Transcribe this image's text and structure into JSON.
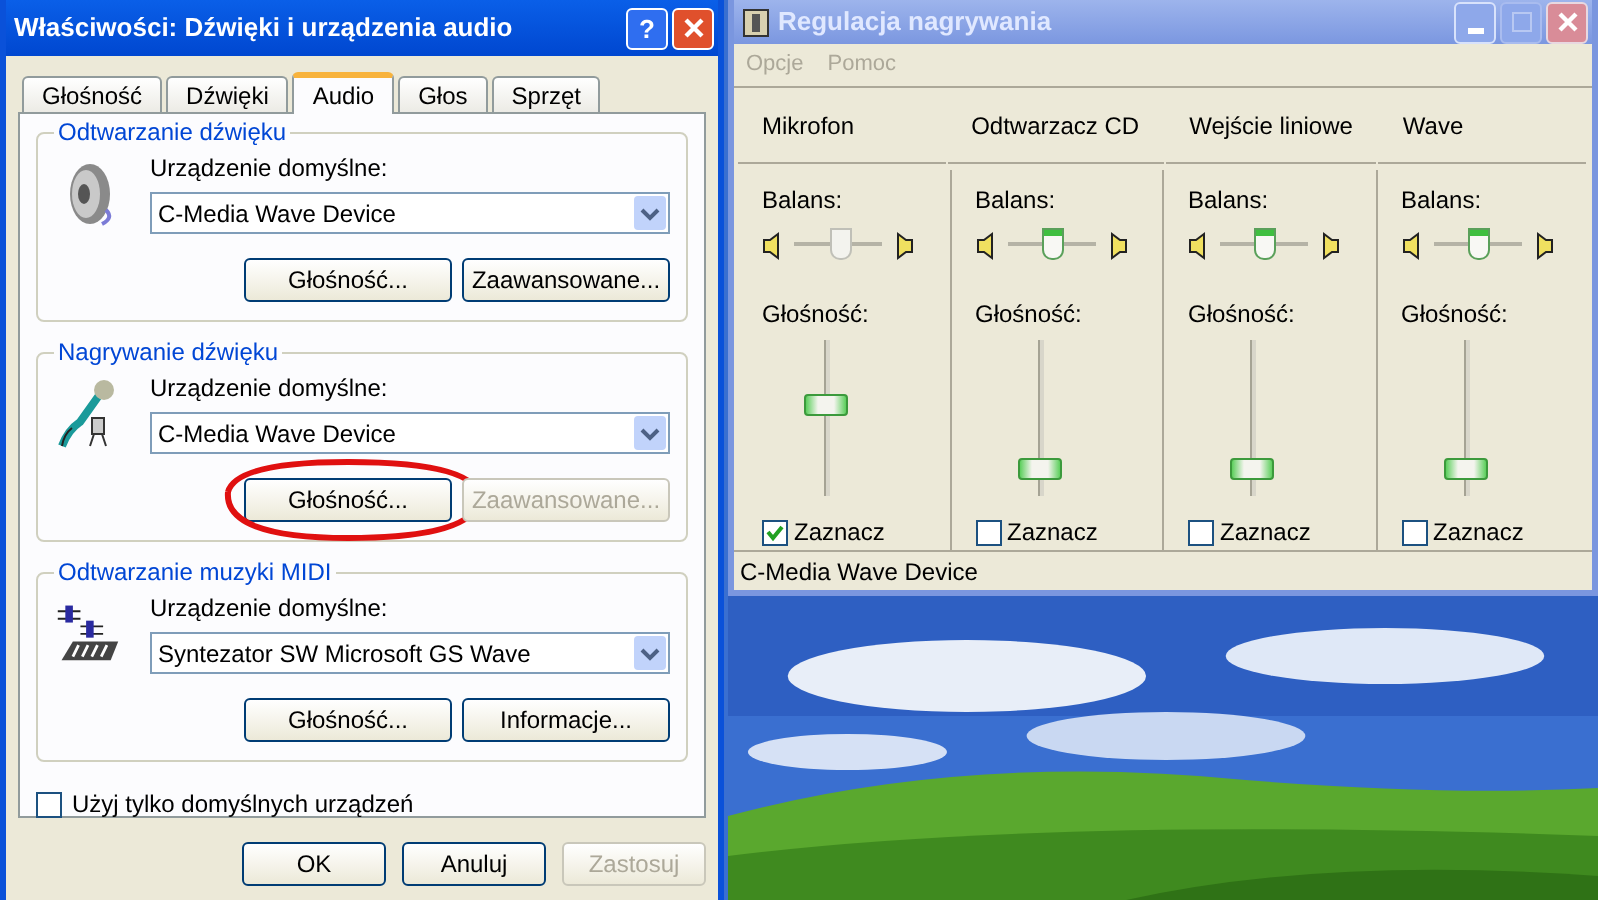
{
  "properties_window": {
    "title": "Właściwości: Dźwięki i urządzenia audio",
    "help_button": "?",
    "tabs": [
      {
        "label": "Głośność",
        "selected": false
      },
      {
        "label": "Dźwięki",
        "selected": false
      },
      {
        "label": "Audio",
        "selected": true
      },
      {
        "label": "Głos",
        "selected": false
      },
      {
        "label": "Sprzęt",
        "selected": false
      }
    ],
    "groups": [
      {
        "kind": "speaker",
        "title": "Odtwarzanie dźwięku",
        "field_label": "Urządzenie domyślne:",
        "value": "C-Media Wave Device",
        "buttons": [
          {
            "label": "Głośność...",
            "disabled": false,
            "circled": false
          },
          {
            "label": "Zaawansowane...",
            "disabled": false,
            "circled": false
          }
        ]
      },
      {
        "kind": "microphone",
        "title": "Nagrywanie dźwięku",
        "field_label": "Urządzenie domyślne:",
        "value": "C-Media Wave Device",
        "buttons": [
          {
            "label": "Głośność...",
            "disabled": false,
            "circled": true
          },
          {
            "label": "Zaawansowane...",
            "disabled": true,
            "circled": false
          }
        ]
      },
      {
        "kind": "midi",
        "title": "Odtwarzanie muzyki MIDI",
        "field_label": "Urządzenie domyślne:",
        "value": "Syntezator SW Microsoft GS Wave",
        "buttons": [
          {
            "label": "Głośność...",
            "disabled": false,
            "circled": false
          },
          {
            "label": "Informacje...",
            "disabled": false,
            "circled": false
          }
        ]
      }
    ],
    "default_only": {
      "label": "Użyj tylko domyślnych urządzeń",
      "checked": false
    },
    "buttons": [
      {
        "label": "OK",
        "disabled": false
      },
      {
        "label": "Anuluj",
        "disabled": false
      },
      {
        "label": "Zastosuj",
        "disabled": true
      }
    ]
  },
  "mixer_window": {
    "title": "Regulacja nagrywania",
    "menu": [
      {
        "label": "Opcje",
        "disabled": true
      },
      {
        "label": "Pomoc",
        "disabled": true
      }
    ],
    "channels": [
      {
        "name": "Mikrofon",
        "balance_label": "Balans:",
        "balance": {
          "level": 0.52,
          "disabled": true
        },
        "volume_label": "Głośność:",
        "volume": {
          "level": 0.6
        },
        "select": {
          "label": "Zaznacz",
          "checked": true
        }
      },
      {
        "name": "Odtwarzacz CD",
        "balance_label": "Balans:",
        "balance": {
          "level": 0.5,
          "disabled": false
        },
        "volume_label": "Głośność:",
        "volume": {
          "level": 0.12
        },
        "select": {
          "label": "Zaznacz",
          "checked": false
        }
      },
      {
        "name": "Wejście liniowe",
        "balance_label": "Balans:",
        "balance": {
          "level": 0.5,
          "disabled": false
        },
        "volume_label": "Głośność:",
        "volume": {
          "level": 0.12
        },
        "select": {
          "label": "Zaznacz",
          "checked": false
        }
      },
      {
        "name": "Wave",
        "balance_label": "Balans:",
        "balance": {
          "level": 0.5,
          "disabled": false
        },
        "volume_label": "Głośność:",
        "volume": {
          "level": 0.12
        },
        "select": {
          "label": "Zaznacz",
          "checked": false
        }
      }
    ],
    "status_bar": "C-Media Wave Device"
  }
}
